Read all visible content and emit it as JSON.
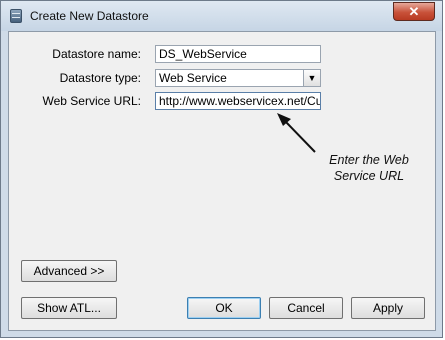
{
  "window": {
    "title": "Create New Datastore",
    "close_label": "✕"
  },
  "form": {
    "name_label": "Datastore name:",
    "name_value": "DS_WebService",
    "type_label": "Datastore type:",
    "type_value": "Web Service",
    "url_label": "Web Service URL:",
    "url_value": "http://www.webservicex.net/Cur"
  },
  "callout": {
    "line1": "Enter the Web",
    "line2": "Service URL"
  },
  "buttons": {
    "advanced": "Advanced >>",
    "show_atl": "Show ATL...",
    "ok": "OK",
    "cancel": "Cancel",
    "apply": "Apply"
  }
}
